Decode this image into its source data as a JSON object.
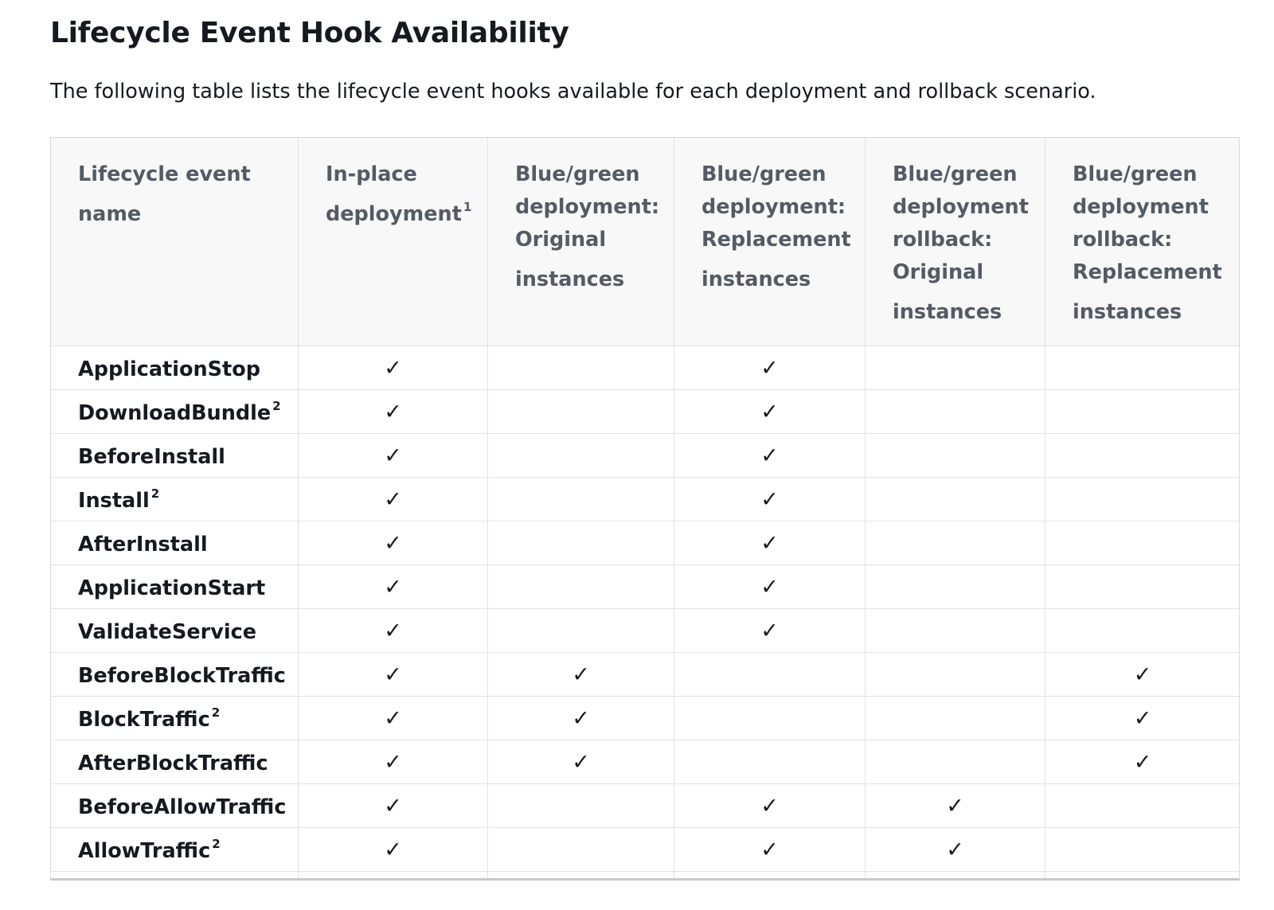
{
  "page": {
    "title": "Lifecycle Event Hook Availability",
    "intro": "The following table lists the lifecycle event hooks available for each deployment and rollback scenario."
  },
  "table": {
    "check_symbol": "✓",
    "columns": [
      {
        "label": "Lifecycle event name",
        "sup": ""
      },
      {
        "label": "In-place deployment",
        "sup": "1"
      },
      {
        "label": "Blue/green deployment: Original instances",
        "sup": ""
      },
      {
        "label": "Blue/green deployment: Replacement instances",
        "sup": ""
      },
      {
        "label": "Blue/green deployment rollback: Original instances",
        "sup": ""
      },
      {
        "label": "Blue/green deployment rollback: Replacement instances",
        "sup": ""
      }
    ],
    "rows": [
      {
        "name": "ApplicationStop",
        "sup": "",
        "checks": [
          "✓",
          "",
          "✓",
          "",
          ""
        ]
      },
      {
        "name": "DownloadBundle",
        "sup": "2",
        "checks": [
          "✓",
          "",
          "✓",
          "",
          ""
        ]
      },
      {
        "name": "BeforeInstall",
        "sup": "",
        "checks": [
          "✓",
          "",
          "✓",
          "",
          ""
        ]
      },
      {
        "name": "Install",
        "sup": "2",
        "checks": [
          "✓",
          "",
          "✓",
          "",
          ""
        ]
      },
      {
        "name": "AfterInstall",
        "sup": "",
        "checks": [
          "✓",
          "",
          "✓",
          "",
          ""
        ]
      },
      {
        "name": "ApplicationStart",
        "sup": "",
        "checks": [
          "✓",
          "",
          "✓",
          "",
          ""
        ]
      },
      {
        "name": "ValidateService",
        "sup": "",
        "checks": [
          "✓",
          "",
          "✓",
          "",
          ""
        ]
      },
      {
        "name": "BeforeBlockTraffic",
        "sup": "",
        "checks": [
          "✓",
          "✓",
          "",
          "",
          "✓"
        ]
      },
      {
        "name": "BlockTraffic",
        "sup": "2",
        "checks": [
          "✓",
          "✓",
          "",
          "",
          "✓"
        ]
      },
      {
        "name": "AfterBlockTraffic",
        "sup": "",
        "checks": [
          "✓",
          "✓",
          "",
          "",
          "✓"
        ]
      },
      {
        "name": "BeforeAllowTraffic",
        "sup": "",
        "checks": [
          "✓",
          "",
          "✓",
          "✓",
          ""
        ]
      },
      {
        "name": "AllowTraffic",
        "sup": "2",
        "checks": [
          "✓",
          "",
          "✓",
          "✓",
          ""
        ]
      }
    ]
  }
}
